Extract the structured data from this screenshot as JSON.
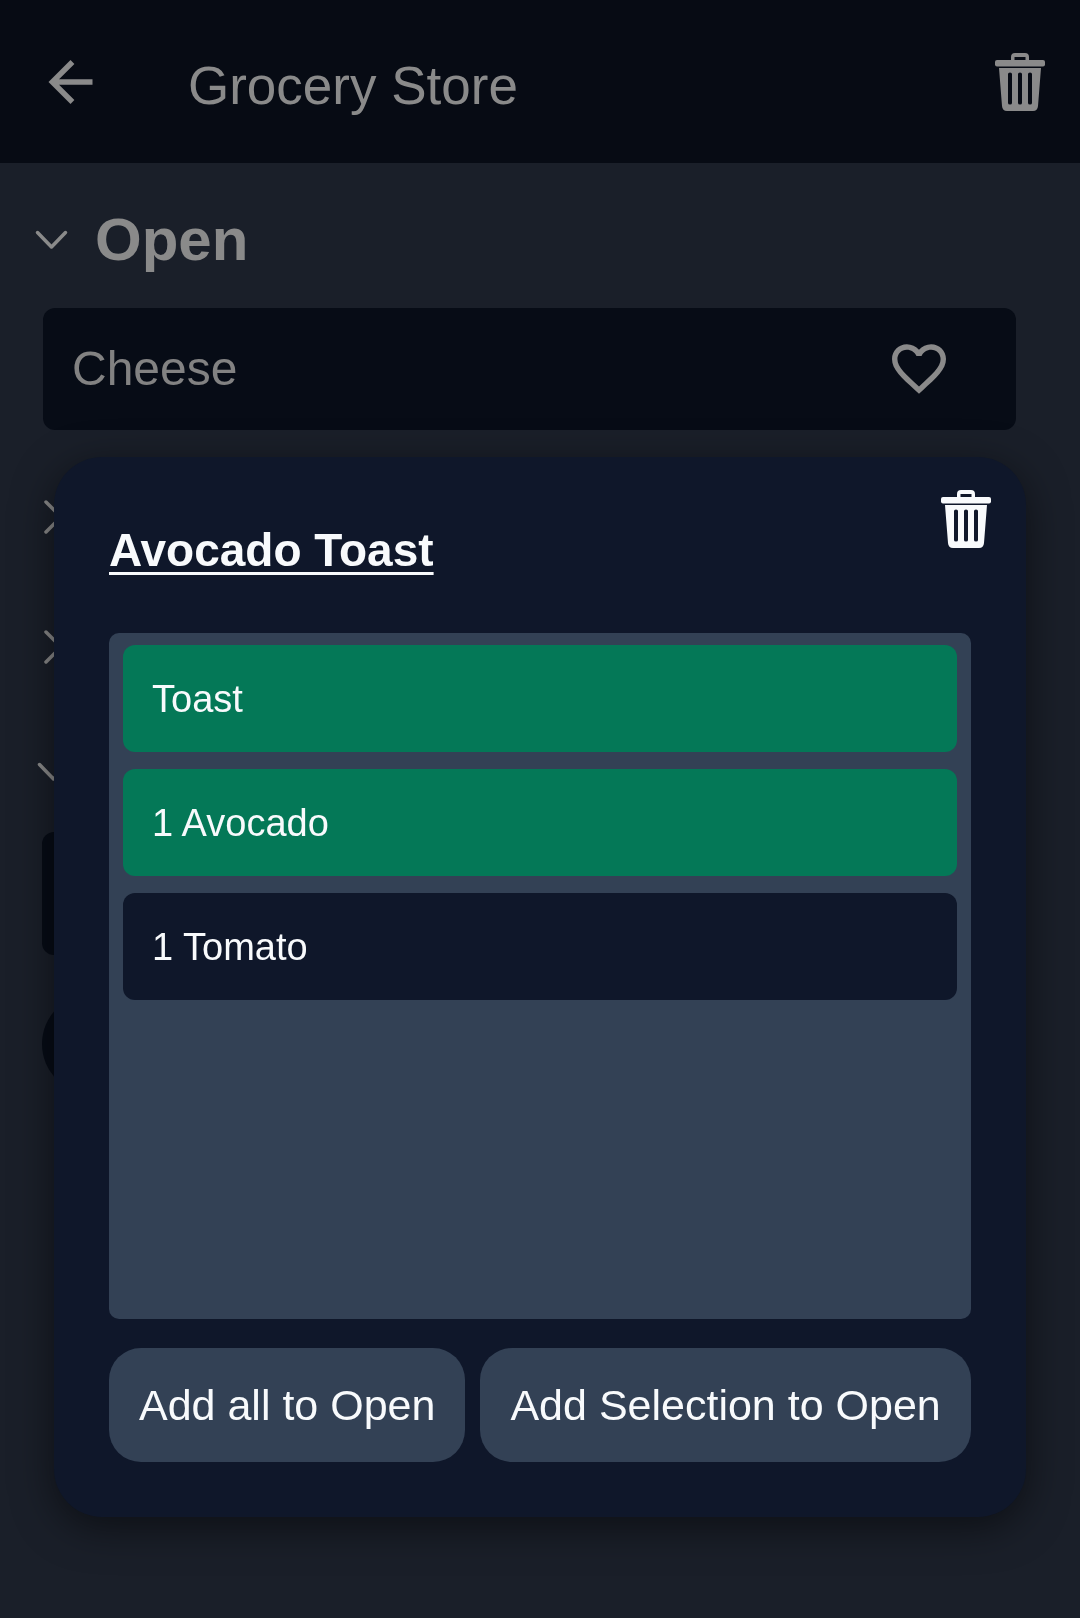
{
  "app_bar": {
    "title": "Grocery Store"
  },
  "sections": [
    {
      "title": "Open",
      "expanded": true,
      "items": [
        {
          "name": "Cheese",
          "favorite": false
        }
      ]
    }
  ],
  "covered_sections": [
    {
      "expanded": false
    },
    {
      "expanded": false
    },
    {
      "expanded": true
    }
  ],
  "dialog": {
    "title": "Avocado Toast",
    "ingredients": [
      {
        "label": "Toast",
        "selected": true
      },
      {
        "label": "1 Avocado",
        "selected": true
      },
      {
        "label": "1 Tomato",
        "selected": false
      }
    ],
    "buttons": [
      {
        "label": "Add all to Open"
      },
      {
        "label": "Add Selection to Open"
      }
    ]
  }
}
